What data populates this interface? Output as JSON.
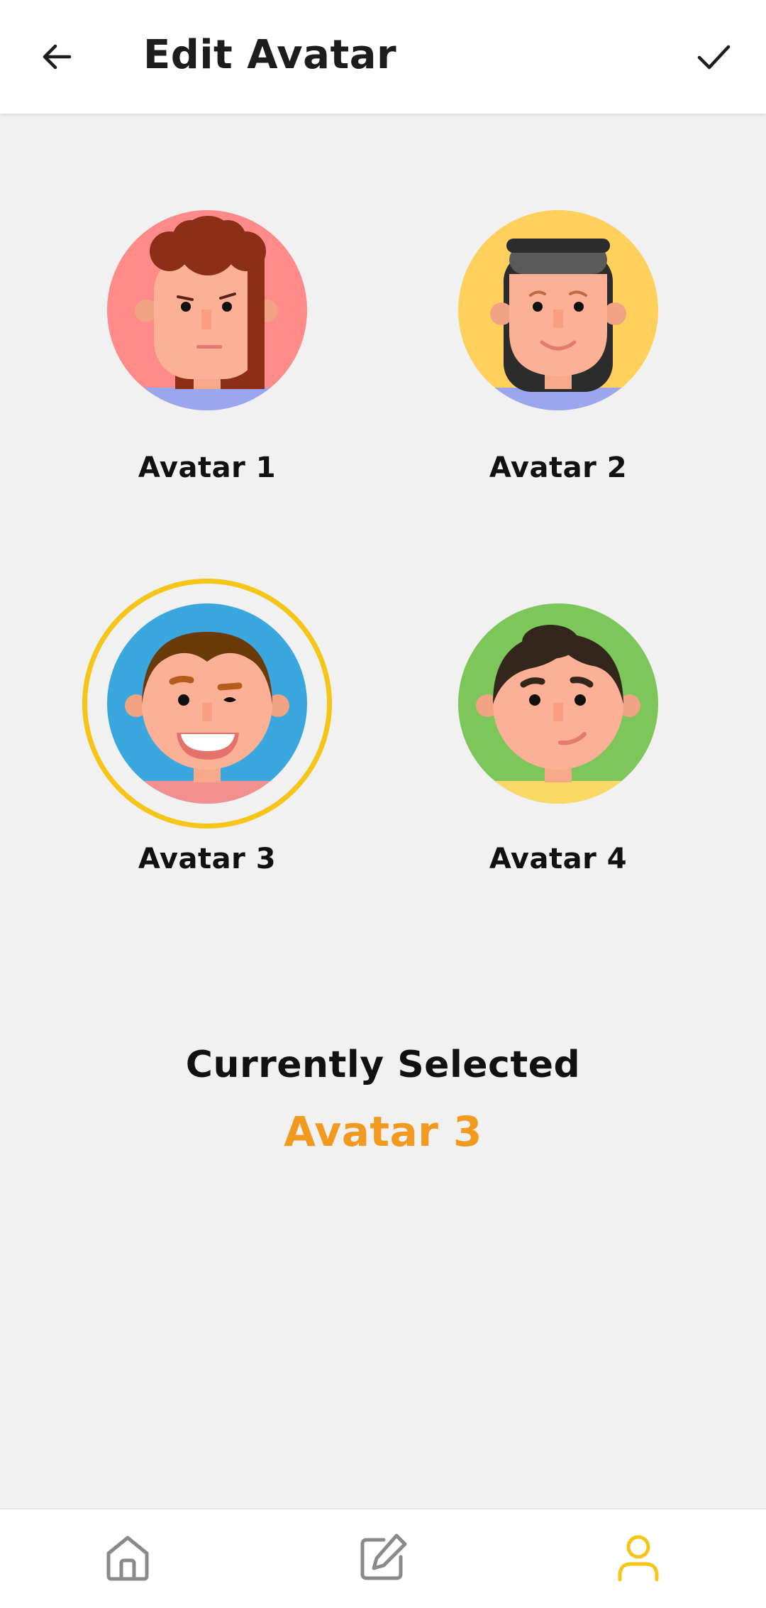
{
  "header": {
    "title": "Edit Avatar",
    "back_icon": "arrow-left-icon",
    "confirm_icon": "check-icon"
  },
  "avatars": [
    {
      "label": "Avatar 1",
      "background": "#ff8a8a",
      "selected": false
    },
    {
      "label": "Avatar 2",
      "background": "#ffd15c",
      "selected": false
    },
    {
      "label": "Avatar 3",
      "background": "#3aa8df",
      "selected": true
    },
    {
      "label": "Avatar 4",
      "background": "#7cc65a",
      "selected": false
    }
  ],
  "selection": {
    "heading": "Currently Selected",
    "value": "Avatar 3"
  },
  "bottom_nav": {
    "items": [
      {
        "icon": "home-icon",
        "active": false
      },
      {
        "icon": "edit-icon",
        "active": false
      },
      {
        "icon": "profile-icon",
        "active": true
      }
    ]
  },
  "colors": {
    "accent": "#f5c518",
    "selected_text": "#f29a1f",
    "nav_inactive": "#8a8a8a",
    "nav_active": "#f5c518"
  }
}
